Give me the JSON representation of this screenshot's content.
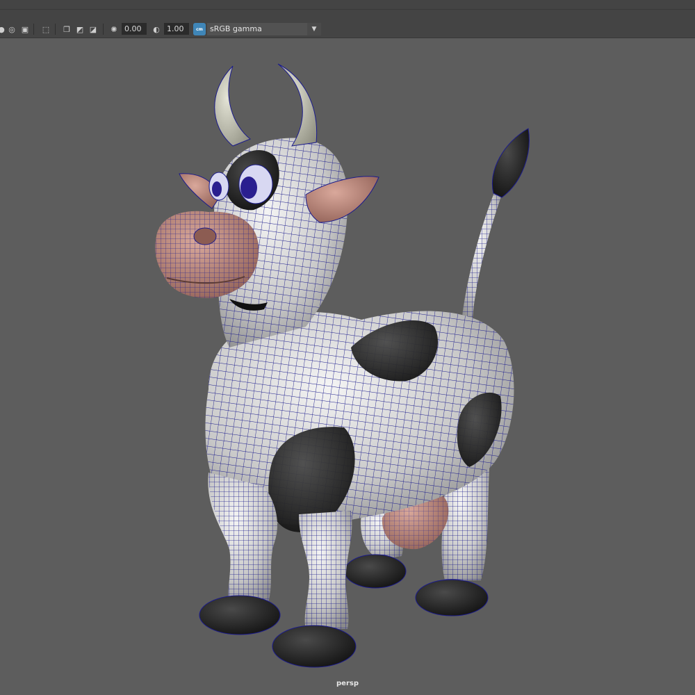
{
  "toolbar": {
    "exposure_value": "0.00",
    "gamma_value": "1.00",
    "colormgmt_badge": "cm",
    "view_transform": "sRGB gamma",
    "icons": [
      "camera-icon",
      "isolate-icon",
      "grid-icon",
      "select-icon",
      "xray-icon",
      "wireframe-icon",
      "toggle-icon",
      "exposure-icon",
      "gamma-icon",
      "color-management-icon",
      "dropdown-arrow-icon"
    ]
  },
  "viewport": {
    "camera_label": "persp",
    "background_color": "#5d5d5d",
    "model": "cartoon cow with wireframe overlay",
    "wire_color": "#1b1b8c"
  }
}
